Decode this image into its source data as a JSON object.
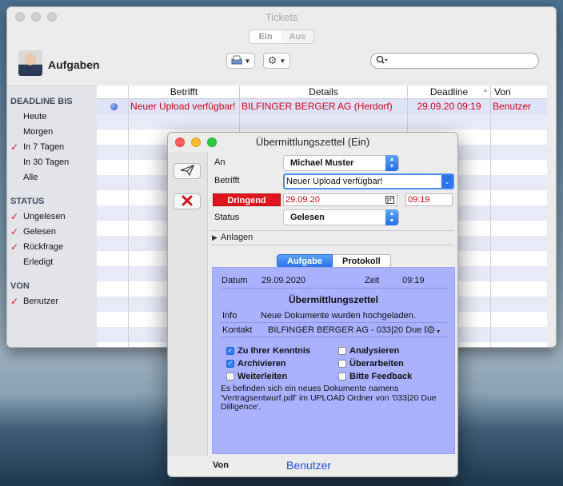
{
  "main_window": {
    "title": "Tickets",
    "segment": [
      "Ein",
      "Aus"
    ],
    "app_title": "Aufgaben",
    "search": {
      "value": "",
      "placeholder": ""
    }
  },
  "sidebar": {
    "sections": [
      {
        "heading": "DEADLINE BIS",
        "items": [
          {
            "label": "Heute",
            "checked": false
          },
          {
            "label": "Morgen",
            "checked": false
          },
          {
            "label": "In 7 Tagen",
            "checked": true
          },
          {
            "label": "In 30 Tagen",
            "checked": false
          },
          {
            "label": "Alle",
            "checked": false
          }
        ]
      },
      {
        "heading": "STATUS",
        "items": [
          {
            "label": "Ungelesen",
            "checked": true
          },
          {
            "label": "Gelesen",
            "checked": true
          },
          {
            "label": "Rückfrage",
            "checked": true
          },
          {
            "label": "Erledigt",
            "checked": false
          }
        ]
      },
      {
        "heading": "VON",
        "items": [
          {
            "label": "Benutzer",
            "checked": true
          }
        ]
      }
    ],
    "check_glyph": "✓"
  },
  "table": {
    "columns": {
      "status": "",
      "betrifft": "Betrifft",
      "details": "Details",
      "deadline": "Deadline",
      "von": "Von"
    },
    "rows": [
      {
        "betrifft": "Neuer Upload verfügbar!",
        "details": "BILFINGER BERGER AG (Herdorf)",
        "deadline": "29.09.20 09:19",
        "von": "Benutzer"
      }
    ],
    "accent_color": "#d0021b"
  },
  "dialog": {
    "title": "Übermittlungszettel (Ein)",
    "labels": {
      "an": "An",
      "betrifft": "Betrifft",
      "status": "Status",
      "anlagen": "Anlagen"
    },
    "an_value": "Michael Muster",
    "betrifft_value": "Neuer Upload verfügbar!",
    "priority": "Dringend",
    "priority_color": "#e4141e",
    "date": "29.09.20",
    "time": "09:19",
    "status_value": "Gelesen",
    "tabs": [
      "Aufgabe",
      "Protokoll"
    ],
    "panel": {
      "datum_label": "Datum",
      "datum_value": "29.09.2020",
      "zeit_label": "Zeit",
      "zeit_value": "09:19",
      "heading": "Übermittlungszettel",
      "info_label": "Info",
      "info_value": "Neue Dokumente wurden hochgeladen.",
      "kontakt_label": "Kontakt",
      "kontakt_value": "BILFINGER BERGER AG - 033|20 Due D",
      "checkboxes": [
        {
          "label": "Zu Ihrer Kenntnis",
          "checked": true
        },
        {
          "label": "Analysieren",
          "checked": false
        },
        {
          "label": "Archivieren",
          "checked": true
        },
        {
          "label": "Überarbeiten",
          "checked": false
        },
        {
          "label": "Weiterleiten",
          "checked": false
        },
        {
          "label": "Bitte Feedback",
          "checked": false
        }
      ],
      "note": "Es befinden sich ein neues Dokumente namens 'Vertragsentwurf.pdf' im UPLOAD Ordner von '033|20 Due Dilligence'.",
      "background_color": "#aab2ff"
    },
    "von_label": "Von",
    "von_value": "Benutzer"
  }
}
